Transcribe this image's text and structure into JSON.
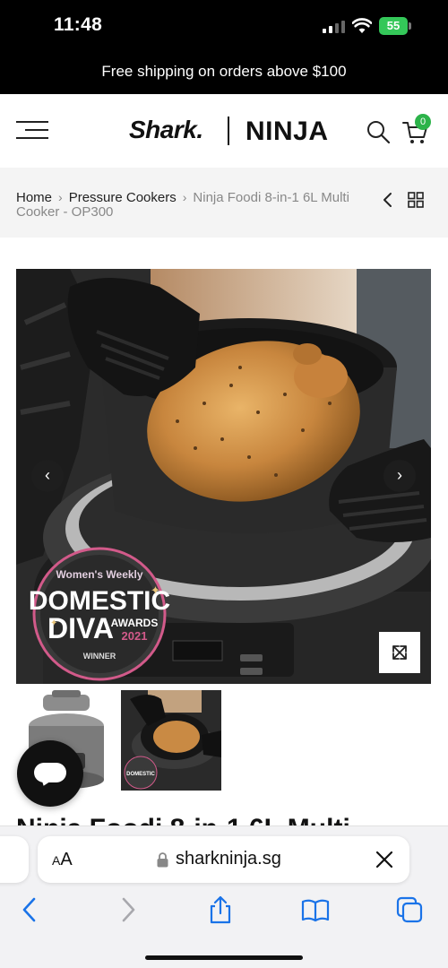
{
  "status_bar": {
    "time": "11:48",
    "battery": "55"
  },
  "announcement": "Free shipping on orders above $100",
  "header": {
    "logo_shark": "Shark.",
    "logo_ninja": "NINJA",
    "cart_count": "0"
  },
  "breadcrumb": {
    "items": [
      "Home",
      "Pressure Cookers"
    ],
    "current": "Ninja Foodi 8-in-1 6L Multi Cooker - OP300"
  },
  "product": {
    "award_lines": [
      "Women's Weekly",
      "DOMESTIC",
      "DIVA",
      "AWARDS",
      "2021",
      "WINNER"
    ],
    "title_partial": "Ninja Foodi 8-in-1 6L Multi"
  },
  "browser": {
    "text_size_label_small": "A",
    "text_size_label_large": "A",
    "domain": "sharkninja.sg"
  },
  "colors": {
    "accent_green": "#2cb34a",
    "ios_blue": "#1a73e8",
    "battery_green": "#34c759"
  }
}
